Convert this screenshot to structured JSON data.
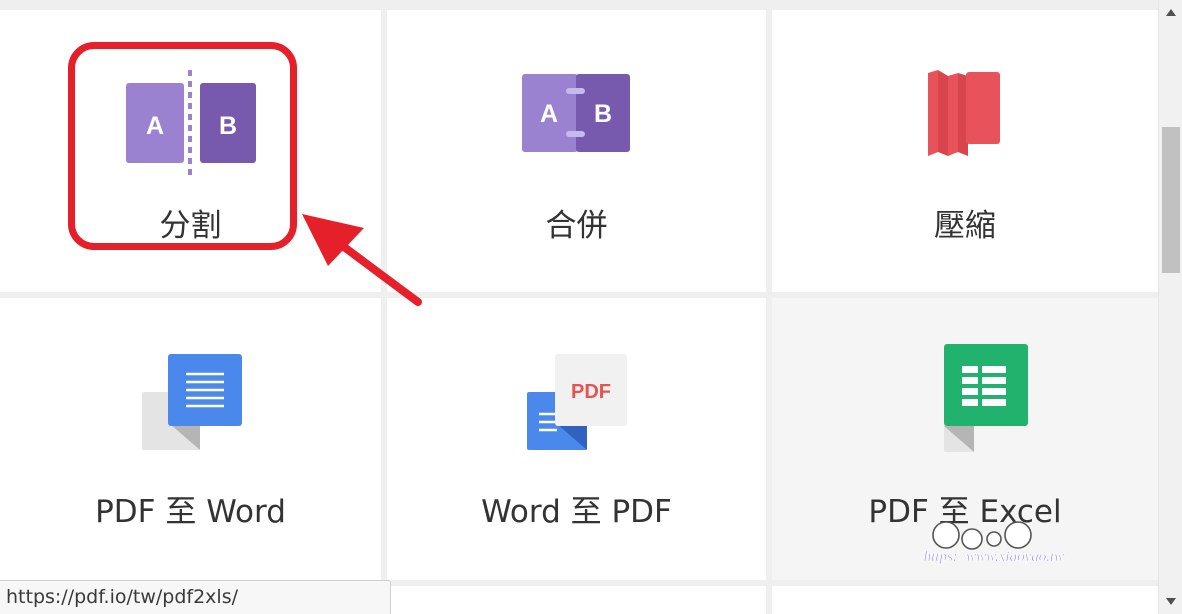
{
  "tools": [
    {
      "label": "分割",
      "icon": "split-icon"
    },
    {
      "label": "合併",
      "icon": "merge-icon"
    },
    {
      "label": "壓縮",
      "icon": "compress-icon"
    },
    {
      "label": "PDF 至 Word",
      "icon": "pdf-to-word-icon"
    },
    {
      "label": "Word 至 PDF",
      "icon": "word-to-pdf-icon"
    },
    {
      "label": "PDF 至 Excel",
      "icon": "pdf-to-excel-icon"
    }
  ],
  "split_icon_letters": {
    "left": "A",
    "right": "B"
  },
  "merge_icon_letters": {
    "left": "A",
    "right": "B"
  },
  "word_to_pdf_badge": "PDF",
  "status_url": "https://pdf.io/tw/pdf2xls/",
  "watermark": {
    "text": "https://www.xiaoyao.tw/"
  },
  "colors": {
    "split_left": "#9b82d0",
    "split_right": "#7759ad",
    "compress": "#e8525a",
    "word_blue": "#4a88ec",
    "excel_green": "#21b36e",
    "pdf_red": "#e25552",
    "highlight": "#e5202a"
  }
}
